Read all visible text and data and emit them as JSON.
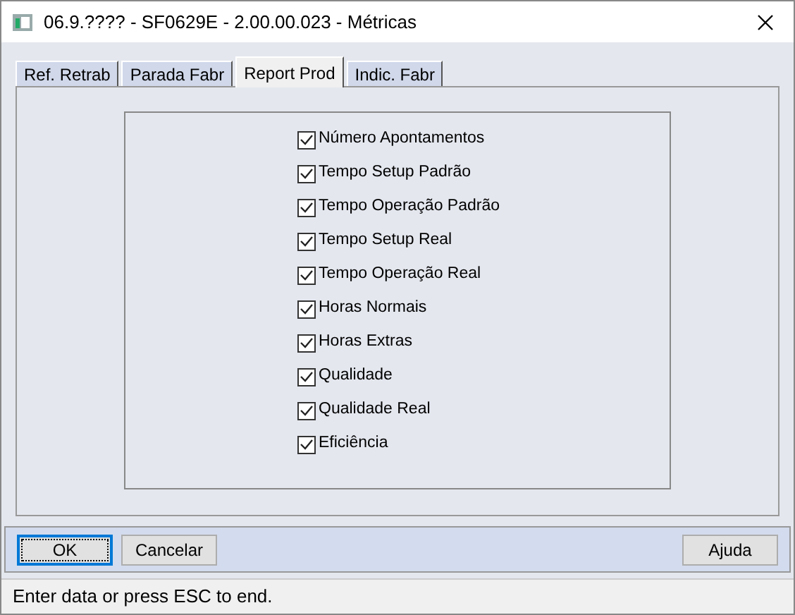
{
  "window": {
    "title": "06.9.???? - SF0629E - 2.00.00.023 - Métricas"
  },
  "tabs": [
    {
      "label": "Ref. Retrab",
      "selected": false
    },
    {
      "label": "Parada Fabr",
      "selected": false
    },
    {
      "label": "Report Prod",
      "selected": true
    },
    {
      "label": "Indic. Fabr",
      "selected": false
    }
  ],
  "options": [
    {
      "label": "Número Apontamentos",
      "checked": true
    },
    {
      "label": "Tempo Setup Padrão",
      "checked": true
    },
    {
      "label": "Tempo Operação Padrão",
      "checked": true
    },
    {
      "label": "Tempo Setup Real",
      "checked": true
    },
    {
      "label": "Tempo Operação Real",
      "checked": true
    },
    {
      "label": "Horas Normais",
      "checked": true
    },
    {
      "label": "Horas Extras",
      "checked": true
    },
    {
      "label": "Qualidade",
      "checked": true
    },
    {
      "label": "Qualidade Real",
      "checked": true
    },
    {
      "label": "Eficiência",
      "checked": true
    }
  ],
  "buttons": {
    "ok": "OK",
    "cancel": "Cancelar",
    "help": "Ajuda"
  },
  "status_bar": "Enter data or press ESC to end."
}
